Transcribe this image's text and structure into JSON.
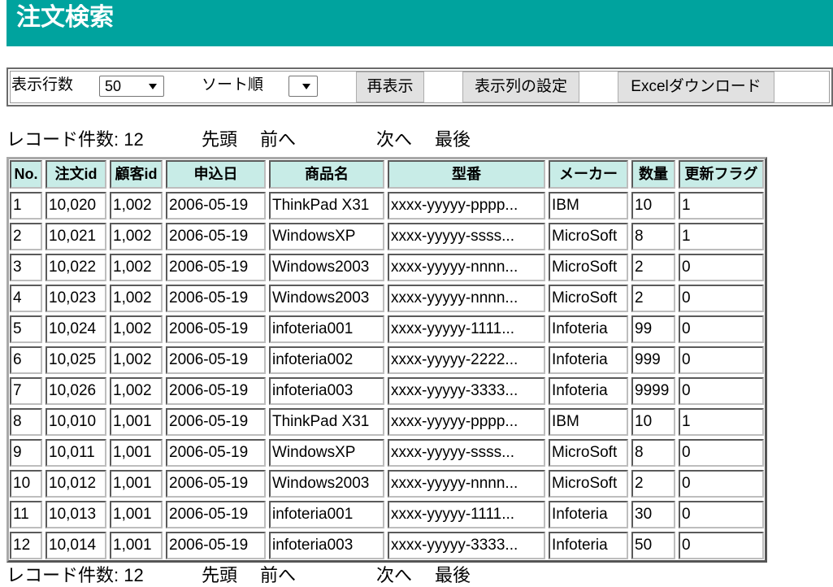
{
  "colors": {
    "accent": "#00a39e",
    "header_cell": "#c8ece7"
  },
  "page": {
    "title": "注文検索"
  },
  "toolbar": {
    "rows_label": "表示行数",
    "rows_value": "50",
    "sort_label": "ソート順",
    "sort_value": "",
    "refresh_button": "再表示",
    "columns_button": "表示列の設定",
    "excel_button": "Excelダウンロード"
  },
  "pager": {
    "record_count_label": "レコード件数:",
    "record_count": "12",
    "first": "先頭",
    "prev": "前へ",
    "next": "次へ",
    "last": "最後"
  },
  "table": {
    "columns": [
      "No.",
      "注文id",
      "顧客id",
      "申込日",
      "商品名",
      "型番",
      "メーカー",
      "数量",
      "更新フラグ"
    ],
    "rows": [
      [
        "1",
        "10,020",
        "1,002",
        "2006-05-19",
        "ThinkPad X31",
        "xxxx-yyyyy-pppp...",
        "IBM",
        "10",
        "1"
      ],
      [
        "2",
        "10,021",
        "1,002",
        "2006-05-19",
        "WindowsXP",
        "xxxx-yyyyy-ssss...",
        "MicroSoft",
        "8",
        "1"
      ],
      [
        "3",
        "10,022",
        "1,002",
        "2006-05-19",
        "Windows2003",
        "xxxx-yyyyy-nnnn...",
        "MicroSoft",
        "2",
        "0"
      ],
      [
        "4",
        "10,023",
        "1,002",
        "2006-05-19",
        "Windows2003",
        "xxxx-yyyyy-nnnn...",
        "MicroSoft",
        "2",
        "0"
      ],
      [
        "5",
        "10,024",
        "1,002",
        "2006-05-19",
        "infoteria001",
        "xxxx-yyyyy-1111...",
        "Infoteria",
        "99",
        "0"
      ],
      [
        "6",
        "10,025",
        "1,002",
        "2006-05-19",
        "infoteria002",
        "xxxx-yyyyy-2222...",
        "Infoteria",
        "999",
        "0"
      ],
      [
        "7",
        "10,026",
        "1,002",
        "2006-05-19",
        "infoteria003",
        "xxxx-yyyyy-3333...",
        "Infoteria",
        "9999",
        "0"
      ],
      [
        "8",
        "10,010",
        "1,001",
        "2006-05-19",
        "ThinkPad X31",
        "xxxx-yyyyy-pppp...",
        "IBM",
        "10",
        "1"
      ],
      [
        "9",
        "10,011",
        "1,001",
        "2006-05-19",
        "WindowsXP",
        "xxxx-yyyyy-ssss...",
        "MicroSoft",
        "8",
        "0"
      ],
      [
        "10",
        "10,012",
        "1,001",
        "2006-05-19",
        "Windows2003",
        "xxxx-yyyyy-nnnn...",
        "MicroSoft",
        "2",
        "0"
      ],
      [
        "11",
        "10,013",
        "1,001",
        "2006-05-19",
        "infoteria001",
        "xxxx-yyyyy-1111...",
        "Infoteria",
        "30",
        "0"
      ],
      [
        "12",
        "10,014",
        "1,001",
        "2006-05-19",
        "infoteria003",
        "xxxx-yyyyy-3333...",
        "Infoteria",
        "50",
        "0"
      ]
    ]
  }
}
